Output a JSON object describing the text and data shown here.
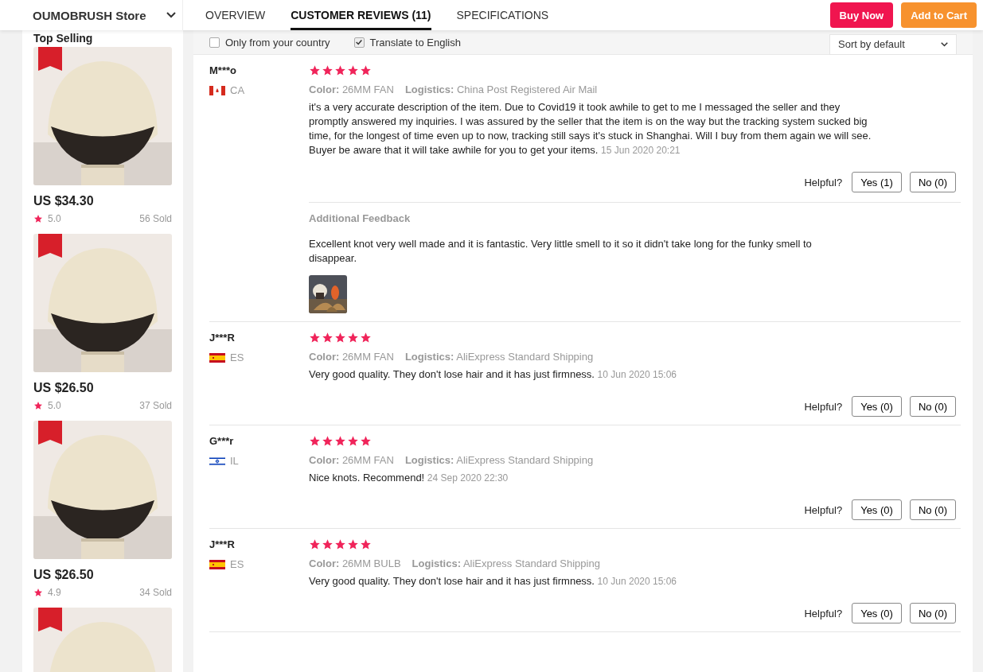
{
  "header": {
    "store": "OUMOBRUSH Store",
    "tabs": [
      {
        "label": "OVERVIEW",
        "selected": false
      },
      {
        "label": "CUSTOMER REVIEWS (11)",
        "selected": true
      },
      {
        "label": "SPECIFICATIONS",
        "selected": false
      }
    ],
    "buy_now": "Buy Now",
    "add_to_cart": "Add to Cart"
  },
  "sidebar": {
    "title": "Top Selling",
    "products": [
      {
        "image": {
          "kind": "picture"
        },
        "price": "US $34.30",
        "rating": "5.0",
        "sold": "56 Sold"
      },
      {
        "image": {
          "kind": "picture"
        },
        "price": "US $26.50",
        "rating": "5.0",
        "sold": "37 Sold"
      },
      {
        "image": {
          "kind": "picture"
        },
        "price": "US $26.50",
        "rating": "4.9",
        "sold": "34 Sold"
      },
      {
        "image": {
          "kind": "picture"
        }
      }
    ]
  },
  "filters": {
    "only_country": {
      "label": "Only from your country",
      "checked": false
    },
    "translate": {
      "label": "Translate to English",
      "checked": true
    },
    "sort": "Sort by default"
  },
  "reviews": [
    {
      "name": "M***o",
      "country": "CA",
      "stars": 5,
      "variant_label": "Color:",
      "variant": "26MM FAN",
      "logistics_label": "Logistics:",
      "logistics": "China Post Registered Air Mail",
      "text": "it's a very accurate description of the item. Due to Covid19 it took awhile to get to me I messaged the seller and they promptly answered my inquiries. I was assured by the seller that the item is on the way but the tracking system sucked big time, for the longest of time even up to now, tracking still says it's stuck in Shanghai. Will I buy from them again we will see. Buyer be aware that it will take awhile for you to get your items.",
      "date": "15 Jun 2020 20:21",
      "helpful": "Helpful?",
      "yes": "Yes (1)",
      "no": "No (0)",
      "additional": {
        "heading": "Additional Feedback",
        "text": "Excellent knot very well made and it is fantastic. Very little smell to it so it didn't take long for the funky smell to disappear.",
        "photo": {
          "kind": "picture"
        }
      }
    },
    {
      "name": "J***R",
      "country": "ES",
      "stars": 5,
      "variant_label": "Color:",
      "variant": "26MM FAN",
      "logistics_label": "Logistics:",
      "logistics": "AliExpress Standard Shipping",
      "text": "Very good quality. They don't lose hair and it has just firmness.",
      "date": "10 Jun 2020 15:06",
      "helpful": "Helpful?",
      "yes": "Yes (0)",
      "no": "No (0)"
    },
    {
      "name": "G***r",
      "country": "IL",
      "stars": 5,
      "variant_label": "Color:",
      "variant": "26MM FAN",
      "logistics_label": "Logistics:",
      "logistics": "AliExpress Standard Shipping",
      "text": "Nice knots. Recommend!",
      "date": "24 Sep 2020 22:30",
      "helpful": "Helpful?",
      "yes": "Yes (0)",
      "no": "No (0)"
    },
    {
      "name": "J***R",
      "country": "ES",
      "stars": 5,
      "variant_label": "Color:",
      "variant": "26MM BULB",
      "logistics_label": "Logistics:",
      "logistics": "AliExpress Standard Shipping",
      "text": "Very good quality. They don't lose hair and it has just firmness.",
      "date": "10 Jun 2020 15:06",
      "helpful": "Helpful?",
      "yes": "Yes (0)",
      "no": "No (0)"
    }
  ]
}
